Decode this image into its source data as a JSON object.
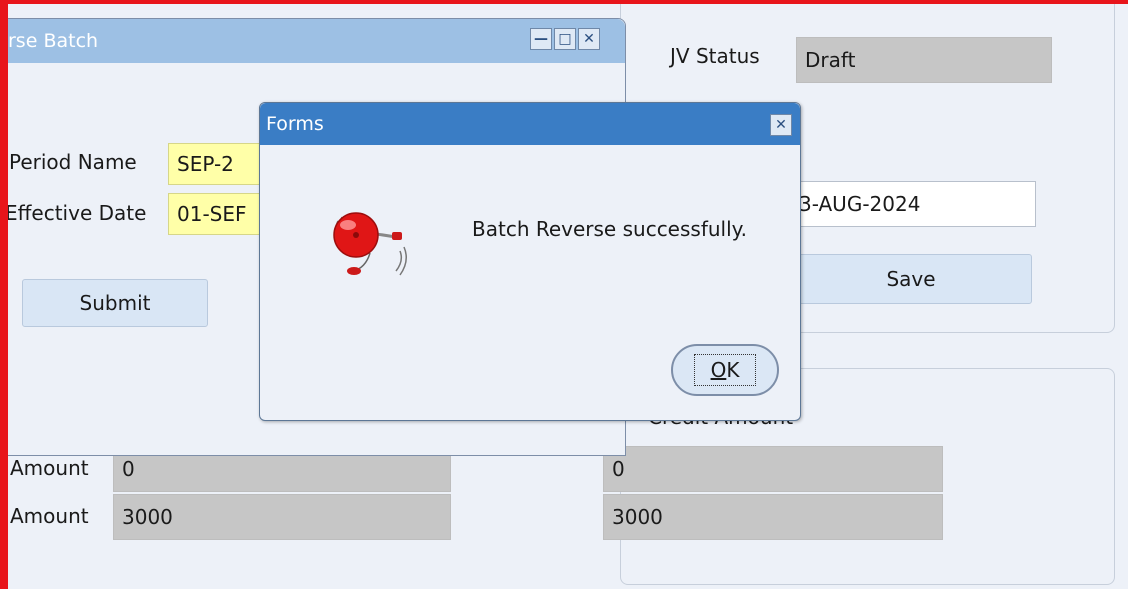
{
  "window": {
    "title": "rse Batch"
  },
  "header": {
    "jv_status_label": "JV Status",
    "jv_status_value": "Draft",
    "date_value": "3-AUG-2024",
    "save_label": "Save"
  },
  "reverse_batch": {
    "period_name_label": "Period Name",
    "period_name_value": "SEP-2",
    "effective_date_label": "Effective Date",
    "effective_date_value": "01-SEF",
    "submit_label": "Submit"
  },
  "totals": {
    "credit_amount_label": "Credit Amount",
    "row1_label": "Amount",
    "row1_debit": "0",
    "row1_credit": "0",
    "row2_label": "Amount",
    "row2_debit": "3000",
    "row2_credit": "3000"
  },
  "dialog": {
    "title": "Forms",
    "message": "Batch Reverse successfully.",
    "ok_underlined": "O",
    "ok_rest": "K",
    "icon": "bell-icon"
  },
  "colors": {
    "frame_red": "#e8151b",
    "dialog_title": "#3a7dc5",
    "window_title": "#9dc0e4",
    "required_field": "#ffffa8",
    "readonly_field": "#c6c6c6"
  }
}
